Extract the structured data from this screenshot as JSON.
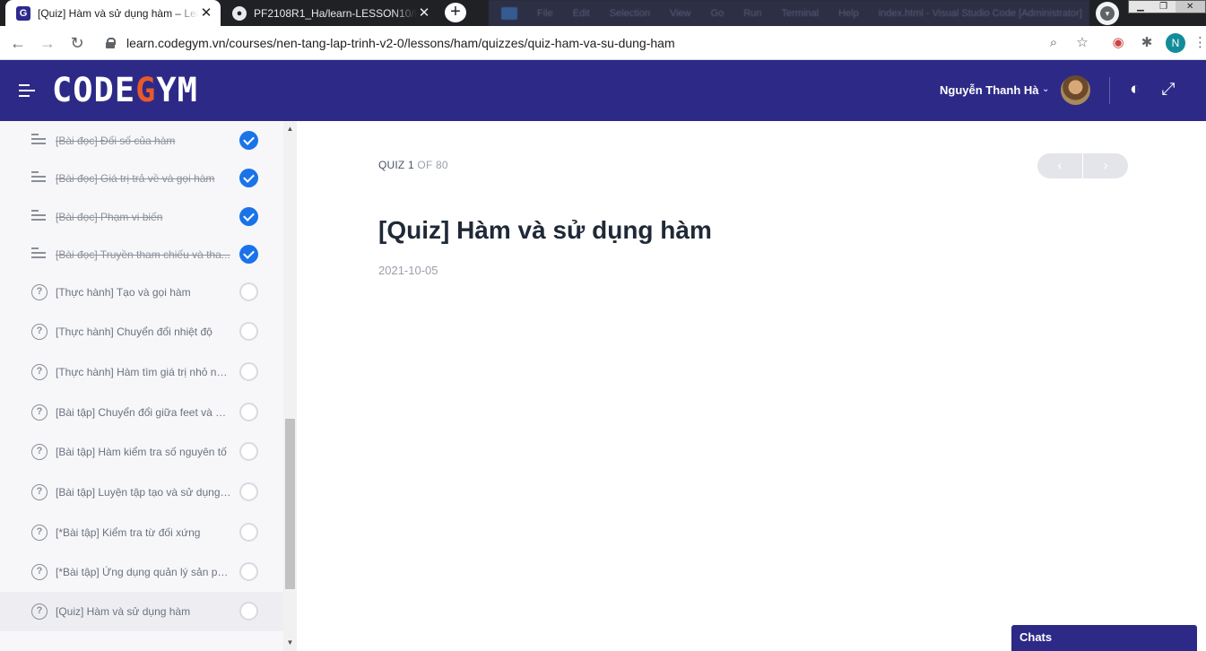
{
  "browser": {
    "tabs": [
      {
        "title": "[Quiz] Hàm và sử dụng hàm – Learn",
        "favicon": "codegym-icon",
        "active": true
      },
      {
        "title": "PF2108R1_Ha/learn-LESSON10/E",
        "favicon": "github-icon",
        "active": false
      }
    ],
    "close_glyph": "✕",
    "new_tab_glyph": "+",
    "background_window_menu": [
      "File",
      "Edit",
      "Selection",
      "View",
      "Go",
      "Run",
      "Terminal",
      "Help",
      "index.html - Visual Studio Code [Administrator]"
    ],
    "window_controls": [
      "▁",
      "❐",
      "✕"
    ],
    "url": "learn.codegym.vn/courses/nen-tang-lap-trinh-v2-0/lessons/ham/quizzes/quiz-ham-va-su-dung-ham",
    "profile_initial": "N",
    "nav_glyphs": {
      "back": "←",
      "forward": "→",
      "reload": "↻",
      "zoom": "⌕",
      "star": "☆",
      "extensions": "✱",
      "menu": "⋮"
    }
  },
  "header": {
    "logo": {
      "before": "CODE",
      "slash": "G",
      "after": "YM"
    },
    "user_name": "Nguyễn Thanh Hà",
    "caret": "⌄",
    "theme_glyph": "◐",
    "fullscreen_glyph": "⤢",
    "colors": {
      "header_bg": "#2d2a87",
      "logo_accent": "#e85a2a"
    }
  },
  "sidebar": {
    "items": [
      {
        "label": "[Bài đọc] Đối số của hàm",
        "type": "reading",
        "done": true
      },
      {
        "label": "[Bài đọc] Giá trị trả về và gọi hàm",
        "type": "reading",
        "done": true
      },
      {
        "label": "[Bài đọc] Phạm vi biến",
        "type": "reading",
        "done": true
      },
      {
        "label": "[Bài đọc] Truyền tham chiếu và tha...",
        "type": "reading",
        "done": true
      },
      {
        "label": "[Thực hành] Tạo và gọi hàm",
        "type": "quiz",
        "done": false
      },
      {
        "label": "[Thực hành] Chuyển đổi nhiệt độ",
        "type": "quiz",
        "done": false
      },
      {
        "label": "[Thực hành] Hàm tìm giá trị nhỏ nh...",
        "type": "quiz",
        "done": false
      },
      {
        "label": "[Bài tập] Chuyển đổi giữa feet và m...",
        "type": "quiz",
        "done": false
      },
      {
        "label": "[Bài tập] Hàm kiểm tra số nguyên tố",
        "type": "quiz",
        "done": false
      },
      {
        "label": "[Bài tập] Luyện tập tạo và sử dụng ...",
        "type": "quiz",
        "done": false
      },
      {
        "label": "[*Bài tập] Kiểm tra từ đối xứng",
        "type": "quiz",
        "done": false
      },
      {
        "label": "[*Bài tập] Ứng dụng quản lý sản ph...",
        "type": "quiz",
        "done": false
      },
      {
        "label": "[Quiz] Hàm và sử dụng hàm",
        "type": "quiz",
        "done": false,
        "current": true
      }
    ],
    "quiz_glyph": "?",
    "scroll_up": "▲",
    "scroll_down": "▼"
  },
  "main": {
    "counter_current": "QUIZ 1",
    "counter_total": "OF 80",
    "prev_glyph": "‹",
    "next_glyph": "›",
    "title": "[Quiz] Hàm và sử dụng hàm",
    "date": "2021-10-05"
  },
  "chats": {
    "label": "Chats"
  }
}
